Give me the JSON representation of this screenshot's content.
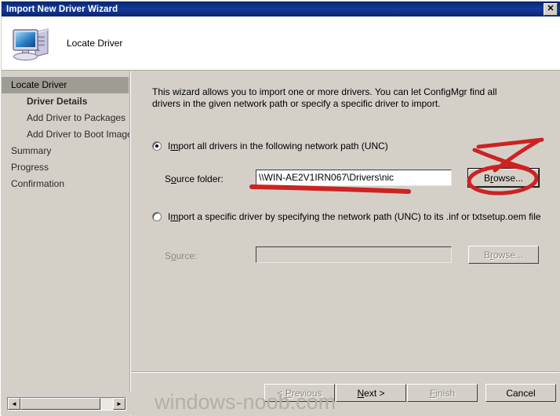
{
  "window": {
    "title": "Import New Driver Wizard",
    "close_label": "✕"
  },
  "header": {
    "page_title": "Locate Driver",
    "icon": "computer-icon"
  },
  "sidebar": {
    "items": [
      {
        "label": "Locate Driver",
        "level": 0,
        "state": "current"
      },
      {
        "label": "Driver Details",
        "level": 1,
        "state": "bold"
      },
      {
        "label": "Add Driver to Packages",
        "level": 1,
        "state": "normal"
      },
      {
        "label": "Add Driver to Boot Images",
        "level": 1,
        "state": "normal"
      },
      {
        "label": "Summary",
        "level": 0,
        "state": "normal"
      },
      {
        "label": "Progress",
        "level": 0,
        "state": "normal"
      },
      {
        "label": "Confirmation",
        "level": 0,
        "state": "normal"
      }
    ]
  },
  "main": {
    "intro": "This wizard allows you to import one or more drivers. You can let ConfigMgr find all drivers in the given network path or specify a specific driver to import.",
    "option_all": {
      "label_pre": "I",
      "label_acc": "m",
      "label_post": "port all drivers in the following network path (UNC)",
      "checked": true
    },
    "source_folder": {
      "label_pre": "S",
      "label_acc": "o",
      "label_post": "urce folder:",
      "value": "\\\\WIN-AE2V1IRN067\\Drivers\\nic",
      "placeholder": ""
    },
    "browse_1": {
      "label_pre": "B",
      "label_acc": "r",
      "label_post": "owse...",
      "enabled": true
    },
    "option_specific": {
      "label_pre": "I",
      "label_acc": "m",
      "label_post": "port a specific driver by specifying the network path (UNC) to its .inf or txtsetup.oem file",
      "checked": false
    },
    "source": {
      "label_pre": "S",
      "label_acc": "o",
      "label_post": "urce:",
      "value": "",
      "placeholder": ""
    },
    "browse_2": {
      "label_pre": "B",
      "label_acc": "r",
      "label_post": "owse...",
      "enabled": false
    }
  },
  "footer": {
    "buttons": [
      {
        "name": "previous",
        "pre": "< ",
        "acc": "P",
        "post": "revious",
        "enabled": false,
        "default": false
      },
      {
        "name": "next",
        "pre": "",
        "acc": "N",
        "post": "ext >",
        "enabled": true,
        "default": true
      },
      {
        "name": "finish",
        "pre": "",
        "acc": "F",
        "post": "inish",
        "enabled": false,
        "default": false
      },
      {
        "name": "cancel",
        "pre": "",
        "acc": "",
        "post": "Cancel",
        "enabled": true,
        "default": false
      }
    ]
  },
  "scrollbar": {
    "left_arrow": "◄",
    "right_arrow": "►"
  },
  "watermark": {
    "text": "windows-noob.com"
  },
  "colors": {
    "titlebar": "#0a246a",
    "face": "#d4d0c8",
    "selection": "#9d9d94",
    "annotation": "#cc2222",
    "watermark": "#b3afa6"
  }
}
